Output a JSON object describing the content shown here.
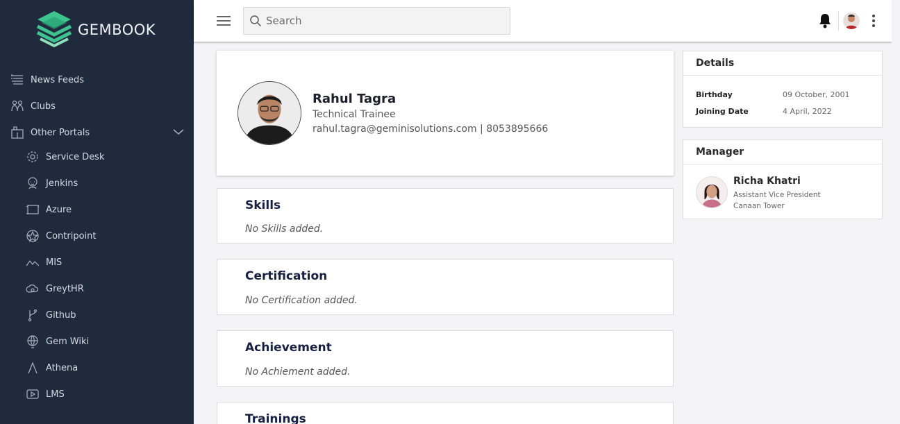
{
  "app": {
    "name": "GEMBOOK"
  },
  "sidebar": {
    "items": [
      {
        "label": "News Feeds",
        "icon": "news-icon"
      },
      {
        "label": "Clubs",
        "icon": "people-icon"
      },
      {
        "label": "Other Portals",
        "icon": "portal-icon"
      }
    ],
    "portals": [
      {
        "label": "Service Desk",
        "icon": "service-desk-icon"
      },
      {
        "label": "Jenkins",
        "icon": "jenkins-icon"
      },
      {
        "label": "Azure",
        "icon": "azure-icon"
      },
      {
        "label": "Contripoint",
        "icon": "contripoint-icon"
      },
      {
        "label": "MIS",
        "icon": "mis-icon"
      },
      {
        "label": "GreytHR",
        "icon": "greythr-icon"
      },
      {
        "label": "Github",
        "icon": "github-icon"
      },
      {
        "label": "Gem Wiki",
        "icon": "wiki-icon"
      },
      {
        "label": "Athena",
        "icon": "athena-icon"
      },
      {
        "label": "LMS",
        "icon": "lms-icon"
      }
    ]
  },
  "header": {
    "search_placeholder": "Search"
  },
  "profile": {
    "name": "Rahul Tagra",
    "role": "Technical Trainee",
    "contact": "rahul.tagra@geminisolutions.com | 8053895666"
  },
  "sections": [
    {
      "title": "Skills",
      "empty": "No Skills added."
    },
    {
      "title": "Certification",
      "empty": "No Certification added."
    },
    {
      "title": "Achievement",
      "empty": "No Achiement added."
    },
    {
      "title": "Trainings"
    }
  ],
  "details": {
    "title": "Details",
    "birthday_label": "Birthday",
    "birthday_value": "09 October, 2001",
    "joining_label": "Joining Date",
    "joining_value": "4 April, 2022"
  },
  "manager": {
    "title": "Manager",
    "name": "Richa Khatri",
    "designation": "Assistant Vice President",
    "location": "Canaan Tower"
  },
  "colors": {
    "sidebar_bg": "#1f2a3d",
    "brand_green": "#3ec38f",
    "heading_navy": "#172043"
  }
}
